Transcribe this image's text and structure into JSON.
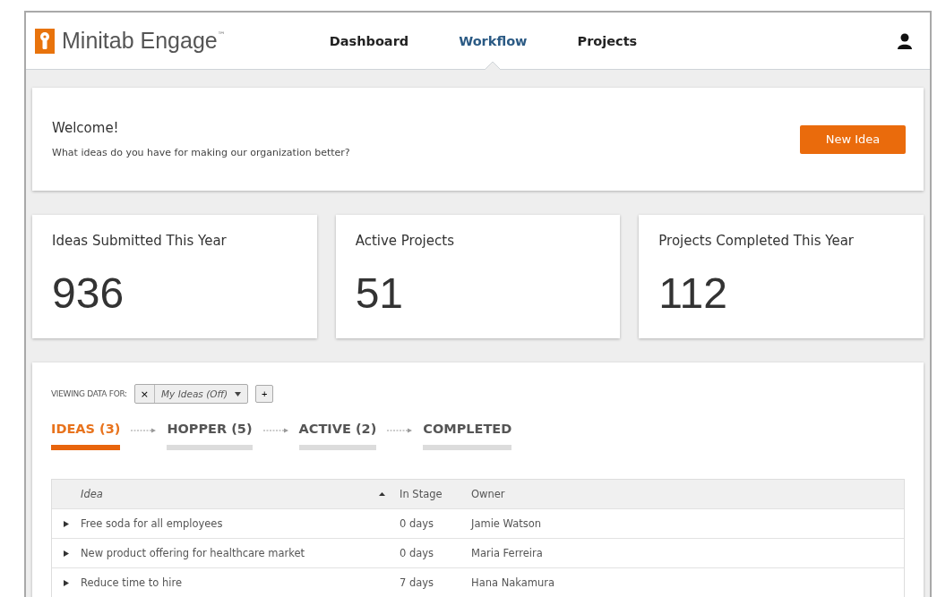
{
  "header": {
    "brand": "Minitab Engage",
    "trademark": "™",
    "nav": [
      {
        "label": "Dashboard",
        "selected": false
      },
      {
        "label": "Workflow",
        "selected": true
      },
      {
        "label": "Projects",
        "selected": false
      }
    ]
  },
  "welcome": {
    "title": "Welcome!",
    "text": "What ideas do you have for making our organization better?",
    "button": "New Idea"
  },
  "stats": [
    {
      "label": "Ideas Submitted This Year",
      "value": "936"
    },
    {
      "label": "Active Projects",
      "value": "51"
    },
    {
      "label": "Projects Completed This Year",
      "value": "112"
    }
  ],
  "filter": {
    "label": "VIEWING DATA FOR:",
    "remove": "×",
    "chip": "My Ideas (Off)",
    "add": "+"
  },
  "stages": [
    {
      "label": "IDEAS (3)",
      "selected": true
    },
    {
      "label": "HOPPER (5)",
      "selected": false
    },
    {
      "label": "ACTIVE (2)",
      "selected": false
    },
    {
      "label": "COMPLETED",
      "selected": false
    }
  ],
  "table": {
    "columns": [
      "Idea",
      "In Stage",
      "Owner"
    ],
    "rows": [
      {
        "idea": "Free soda for all employees",
        "in_stage": "0 days",
        "owner": "Jamie Watson"
      },
      {
        "idea": "New product offering for healthcare market",
        "in_stage": "0 days",
        "owner": "Maria Ferreira"
      },
      {
        "idea": "Reduce time to hire",
        "in_stage": "7 days",
        "owner": "Hana Nakamura"
      }
    ]
  }
}
